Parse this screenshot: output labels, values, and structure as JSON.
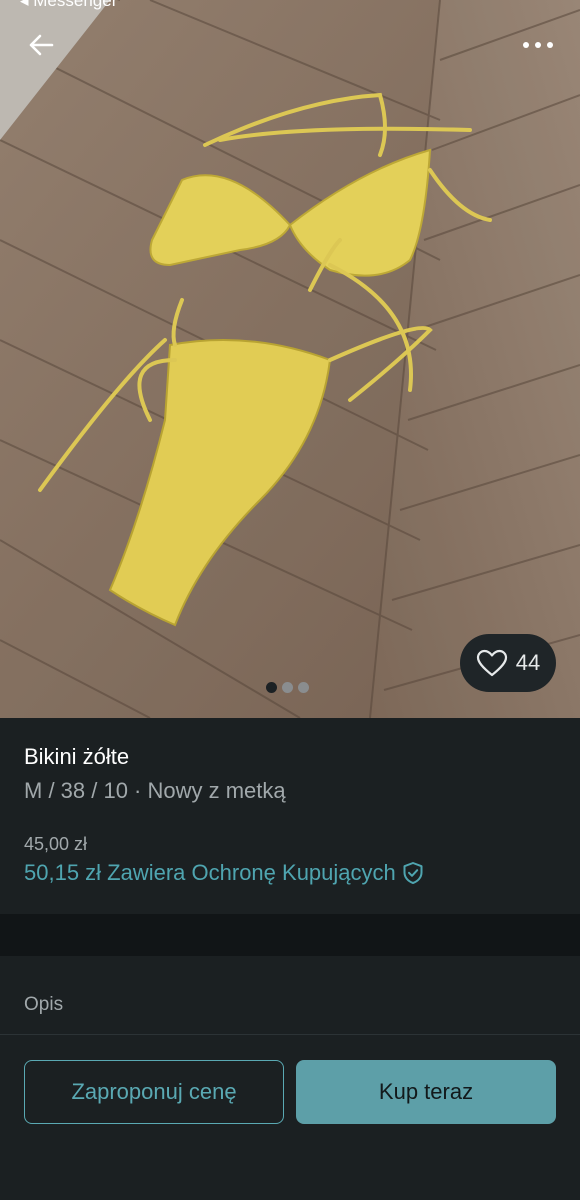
{
  "status_bar": {
    "back_app_label": "◂ Messenger"
  },
  "gallery": {
    "likes_count": "44",
    "image_count": 3,
    "active_image": 1
  },
  "item": {
    "title": "Bikini żółte",
    "subtitle": "M / 38 / 10 · Nowy z metką",
    "price": "45,00 zł",
    "total_with_protection": "50,15 zł Zawiera Ochronę Kupujących"
  },
  "description": {
    "label": "Opis"
  },
  "actions": {
    "offer_label": "Zaproponuj cenę",
    "buy_label": "Kup teraz"
  },
  "colors": {
    "accent": "#4fa5b0",
    "buy_button": "#5d9fa8",
    "background": "#1b2022"
  },
  "icons": {
    "back": "arrow-left-icon",
    "more": "more-dots-icon",
    "like": "heart-icon",
    "protection": "shield-check-icon"
  }
}
